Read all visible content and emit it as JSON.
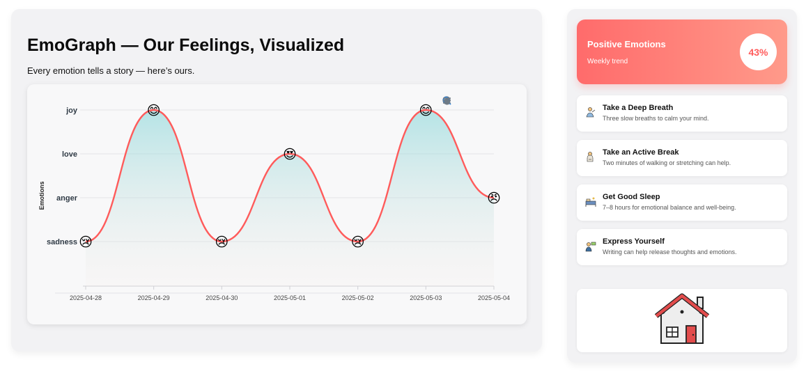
{
  "header": {
    "title": "EmoGraph — Our Feelings, Visualized",
    "subtitle": "Every emotion tells a story — here’s ours."
  },
  "toolbar": {
    "icons": [
      "zoom-in-icon",
      "zoom-out-icon",
      "zoom-selection-icon",
      "pan-icon",
      "home-reset-icon",
      "menu-icon"
    ]
  },
  "chart_data": {
    "type": "line",
    "smooth": true,
    "area_fill": true,
    "ylabel": "Emotions",
    "xlabel": "",
    "y_categories": [
      "sadness",
      "anger",
      "love",
      "joy"
    ],
    "x": [
      "2025-04-28",
      "2025-04-29",
      "2025-04-30",
      "2025-05-01",
      "2025-05-02",
      "2025-05-03",
      "2025-05-04"
    ],
    "series": [
      {
        "values": [
          "sadness",
          "joy",
          "sadness",
          "love",
          "sadness",
          "joy",
          "anger"
        ],
        "markers": [
          "😢",
          "😊",
          "😢",
          "😍",
          "😢",
          "😊",
          "😠"
        ]
      }
    ],
    "line_color": "#ff5b5b",
    "fill_color": "#7fd3d6",
    "grid": true
  },
  "sidebar": {
    "positive": {
      "title": "Positive Emotions",
      "subtitle": "Weekly trend",
      "percent": "43%"
    },
    "tips": [
      {
        "icon": "meditation-icon",
        "title": "Take a Deep Breath",
        "desc": "Three slow breaths to calm your mind."
      },
      {
        "icon": "walking-icon",
        "title": "Take an Active Break",
        "desc": "Two minutes of walking or stretching can help."
      },
      {
        "icon": "bed-icon",
        "title": "Get Good Sleep",
        "desc": "7–8 hours for emotional balance and well-being."
      },
      {
        "icon": "writing-icon",
        "title": "Express Yourself",
        "desc": "Writing can help release thoughts and emotions."
      }
    ]
  },
  "colors": {
    "accent": "#ff6b6b",
    "accent_light": "#ff9a8a",
    "panel": "#f2f2f4"
  }
}
